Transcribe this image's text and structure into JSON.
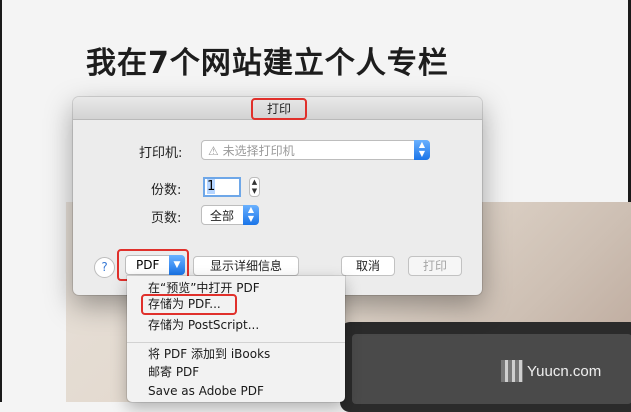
{
  "article": {
    "title": "我在7个网站建立个人专栏"
  },
  "dialog": {
    "title": "打印",
    "printer_label": "打印机:",
    "printer_value": "⚠ 未选择打印机",
    "copies_label": "份数:",
    "copies_value": "1",
    "pages_label": "页数:",
    "pages_value": "全部",
    "help_label": "?",
    "pdf_label": "PDF",
    "details_label": "显示详细信息",
    "cancel_label": "取消",
    "print_label": "打印"
  },
  "pdf_menu": {
    "items": [
      "在“预览”中打开 PDF",
      "存储为 PDF...",
      "存储为 PostScript...",
      "将 PDF 添加到 iBooks",
      "邮寄 PDF",
      "Save as Adobe PDF"
    ]
  },
  "watermark": {
    "text": "Yuucn.com"
  },
  "colors": {
    "highlight": "#e0302b",
    "accent": "#1a74e8"
  }
}
